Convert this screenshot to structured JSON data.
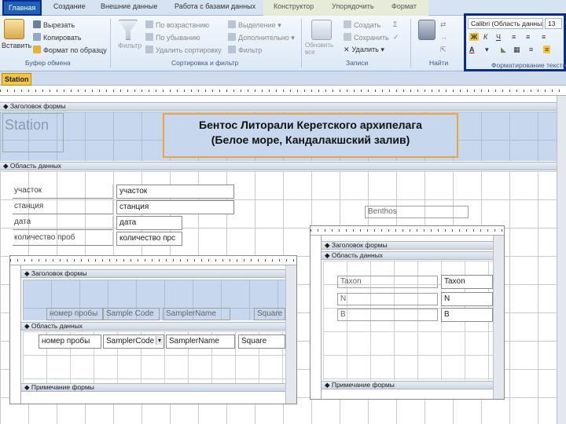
{
  "ribbon": {
    "tabs": [
      "Главная",
      "Создание",
      "Внешние данные",
      "Работа с базами данных",
      "Конструктор",
      "Упорядочить",
      "Формат"
    ],
    "clipboard": {
      "paste": "Вставить",
      "cut": "Вырезать",
      "copy": "Копировать",
      "format_painter": "Формат по образцу",
      "group": "Буфер обмена"
    },
    "sort": {
      "filter": "Фильтр",
      "ascending": "По возрастанию",
      "descending": "По убыванию",
      "remove_sort": "Удалить сортировку",
      "selection": "Выделение",
      "advanced": "Дополнительно",
      "toggle_filter": "Фильтр",
      "group": "Сортировка и фильтр"
    },
    "records": {
      "refresh": "Обновить все",
      "new": "Создать",
      "save": "Сохранить",
      "delete": "Удалить",
      "group": "Записи"
    },
    "find": {
      "group": "Найти"
    },
    "format": {
      "font": "Calibri (Область данных)",
      "size": "13",
      "bold": "Ж",
      "italic": "К",
      "underline": "Ч",
      "group": "Форматирование текста"
    }
  },
  "document": {
    "tab": "Station",
    "sections": {
      "form_header": "Заголовок формы",
      "detail": "Область данных"
    },
    "header": {
      "station_label": "Station",
      "title_line1": "Бентос Литорали Керетского архипелага",
      "title_line2": "(Белое море, Кандалакшский залив)"
    },
    "fields": [
      {
        "label": "участок",
        "value": "участок"
      },
      {
        "label": "станция",
        "value": "станция"
      },
      {
        "label": "дата",
        "value": "дата"
      },
      {
        "label": "количество проб",
        "value": "количество прс"
      }
    ],
    "benthos_label": "Benthos"
  },
  "subform_left": {
    "sections": {
      "form_header": "Заголовок формы",
      "detail": "Область данных",
      "footer": "Примечание формы"
    },
    "headers": [
      "номер пробы",
      "Sample Code",
      "SamplerName",
      "Square"
    ],
    "fields": [
      "номер пробы",
      "SamplerCode",
      "SamplerName",
      "Square"
    ]
  },
  "subform_right": {
    "sections": {
      "form_header": "Заголовок формы",
      "detail": "Область данных",
      "footer": "Примечание формы"
    },
    "labels": [
      "Taxon",
      "N",
      "B"
    ],
    "fields": [
      "Taxon",
      "N",
      "B"
    ]
  }
}
